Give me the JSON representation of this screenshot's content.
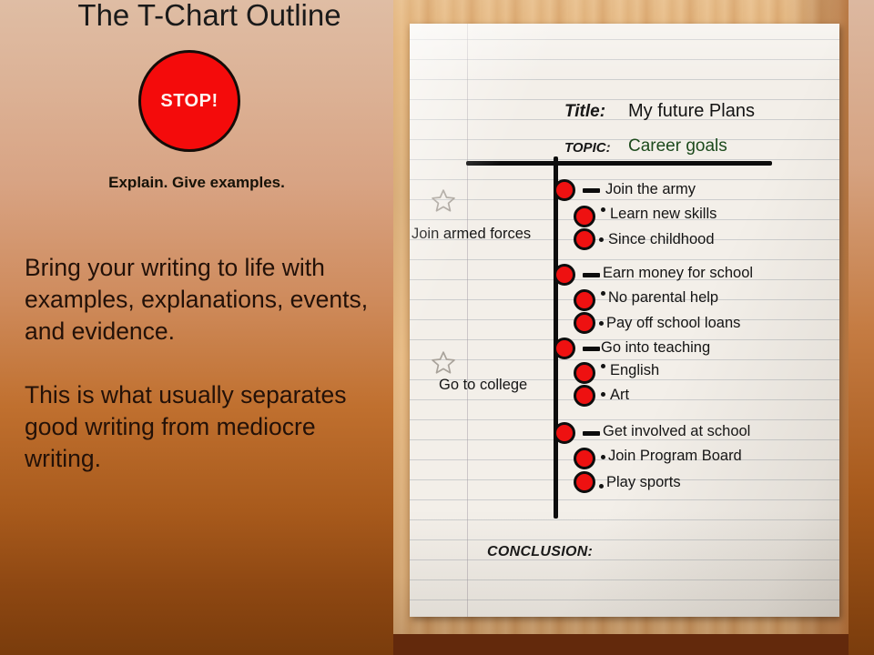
{
  "slide": {
    "title": "The T-Chart Outline",
    "stop_badge": "STOP!",
    "explain_line": "Explain. Give examples.",
    "paragraphs": [
      "Bring your writing to life with examples, explanations, events, and evidence.",
      "This is what usually separates good writing from mediocre writing."
    ],
    "colors": {
      "stop_fill": "#ee0b0b",
      "dot_fill": "#ee1111",
      "ink": "#0d0d0d",
      "topic_green": "#1c4a1c",
      "paper": "#f3efe9",
      "wood": "#e3b57d"
    }
  },
  "worksheet": {
    "title_label": "Title:",
    "title_value": "My future Plans",
    "topic_label": "TOPIC:",
    "topic_value": "Career goals",
    "conclusion_label": "CONCLUSION:",
    "groups": [
      {
        "star": "star-outline-icon",
        "label": "Join armed forces",
        "main": "Join the army",
        "subs": [
          "Learn new skills",
          "Since childhood"
        ]
      },
      {
        "star": null,
        "label": null,
        "main": "Earn money for school",
        "subs": [
          "No parental help",
          "Pay off school loans"
        ]
      },
      {
        "star": "star-outline-icon",
        "label": "Go to college",
        "main": "Go into teaching",
        "subs": [
          "English",
          "Art"
        ]
      },
      {
        "star": null,
        "label": null,
        "main": "Get involved at school",
        "subs": [
          "Join Program Board",
          "Play sports"
        ]
      }
    ]
  }
}
